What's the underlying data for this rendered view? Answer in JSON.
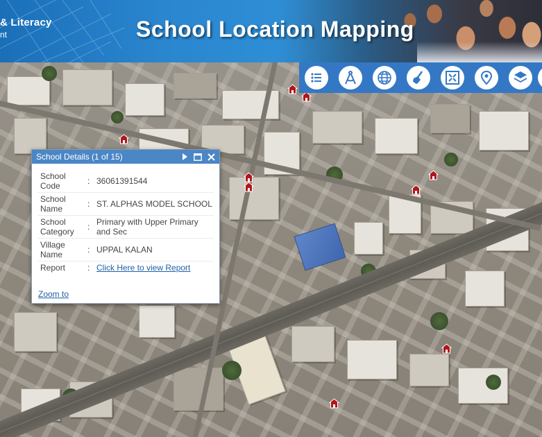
{
  "header": {
    "org_name": "& Literacy",
    "org_sub": "nt",
    "title": "School Location Mapping"
  },
  "toolbar": {
    "tools": [
      {
        "name": "legend-list-icon"
      },
      {
        "name": "measure-compass-icon"
      },
      {
        "name": "globe-basemap-icon"
      },
      {
        "name": "clear-broom-icon"
      },
      {
        "name": "extent-zoom-icon"
      },
      {
        "name": "location-pin-icon"
      },
      {
        "name": "layers-icon"
      },
      {
        "name": "more-tool-icon"
      }
    ]
  },
  "popup": {
    "title": "School Details (1 of 15)",
    "rows": [
      {
        "label": "School Code",
        "value": "36061391544"
      },
      {
        "label": "School Name",
        "value": "ST. ALPHAS MODEL SCHOOL"
      },
      {
        "label": "School Category",
        "value": "Primary with Upper Primary and Sec"
      },
      {
        "label": "Village Name",
        "value": "UPPAL KALAN"
      },
      {
        "label": "Report",
        "value": "Click Here to view Report"
      }
    ],
    "separator": ":",
    "zoom_label": "Zoom to"
  },
  "map": {
    "marker_icon": "school-house-icon",
    "marker_color": "#b0161b",
    "marker_count": 11
  }
}
